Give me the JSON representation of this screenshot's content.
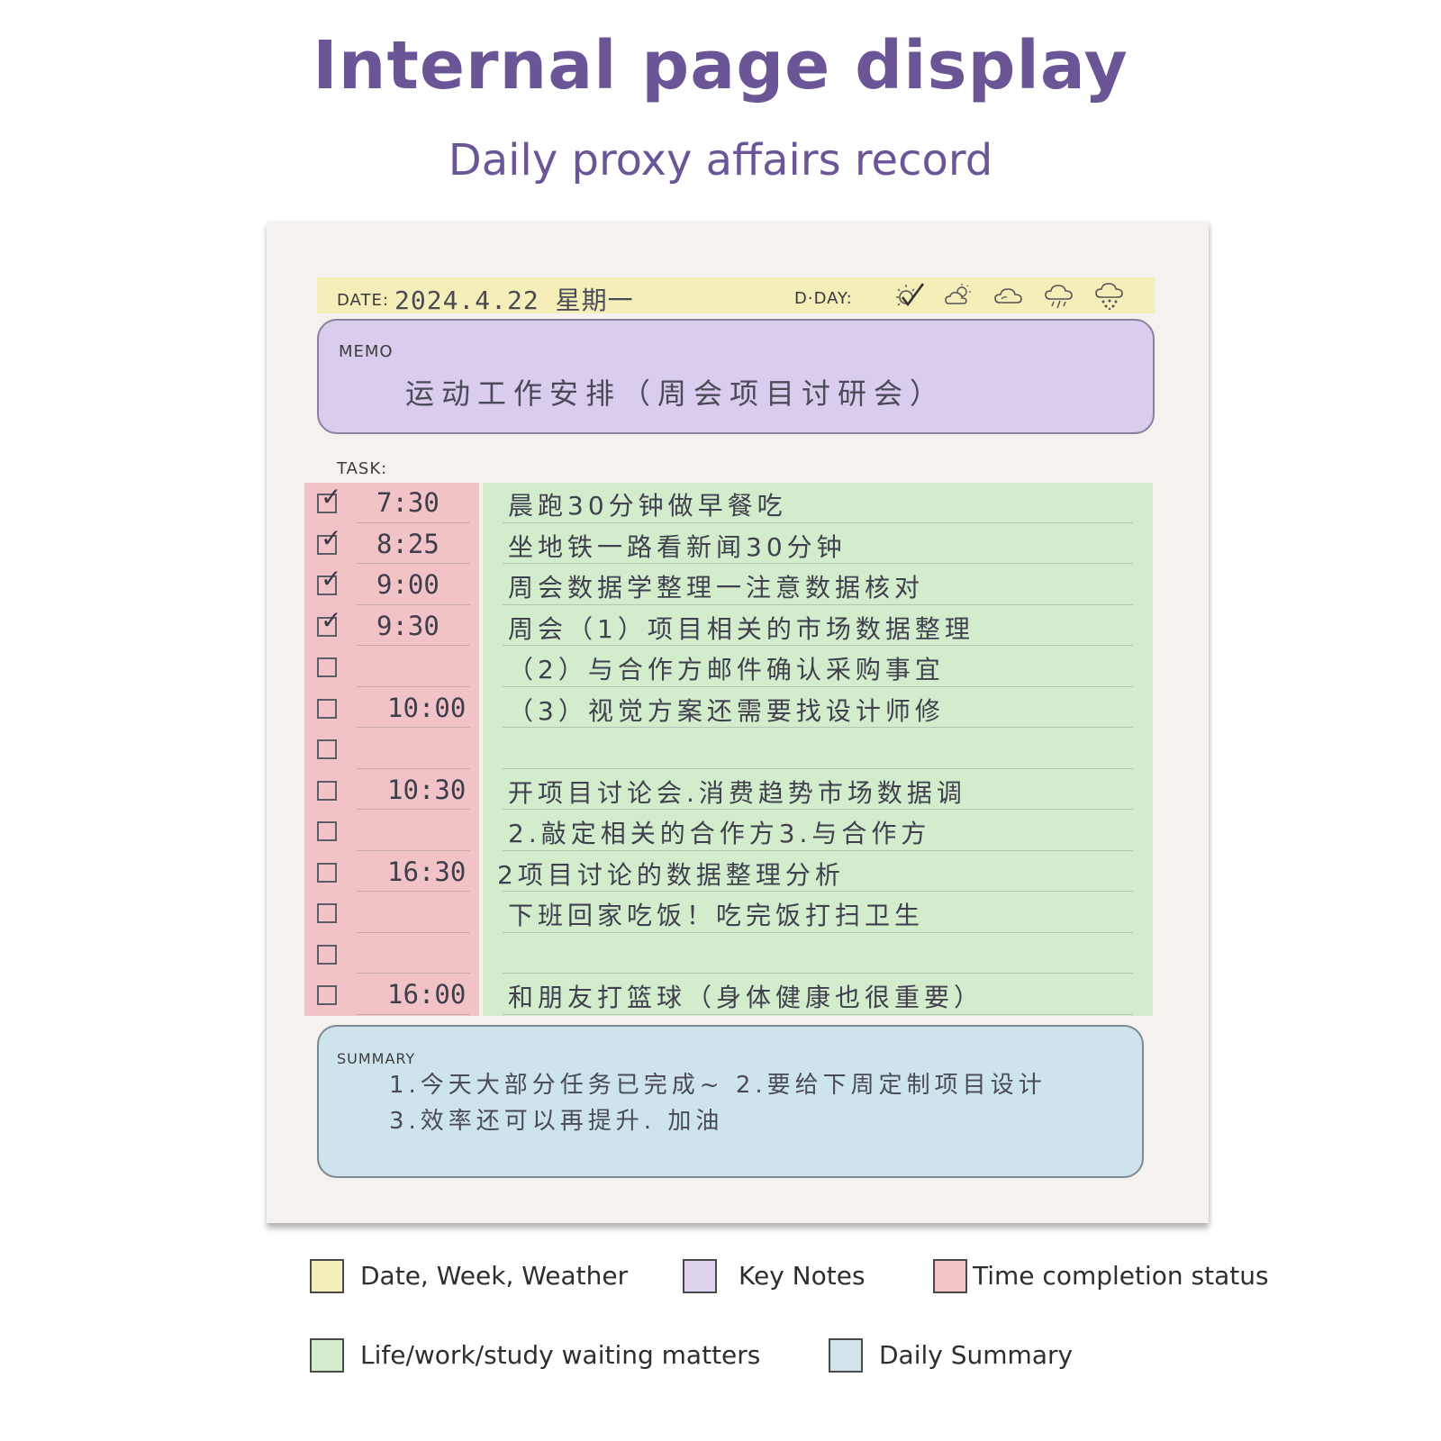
{
  "header": {
    "title": "Internal page display",
    "subtitle": "Daily proxy affairs record"
  },
  "planner": {
    "date_label": "DATE:",
    "date_value": "2024.4.22 星期一",
    "dday_label": "D·DAY:",
    "weather_icons": [
      "sunny-checked-icon",
      "partly-cloudy-icon",
      "cloudy-icon",
      "rain-icon",
      "snow-icon"
    ],
    "memo_label": "MEMO",
    "memo_text": "运动工作安排（周会项目讨研会）",
    "task_label": "TASK:",
    "tasks": [
      {
        "checked": true,
        "time": "7:30",
        "text": "晨跑30分钟做早餐吃"
      },
      {
        "checked": true,
        "time": "8:25",
        "text": "坐地铁一路看新闻30分钟"
      },
      {
        "checked": true,
        "time": "9:00",
        "text": "周会数据学整理一注意数据核对"
      },
      {
        "checked": true,
        "time": "9:30",
        "text": "周会（1）项目相关的市场数据整理"
      },
      {
        "checked": false,
        "time": "",
        "text": "（2）与合作方邮件确认采购事宜"
      },
      {
        "checked": false,
        "time": "10:00",
        "text": "（3）视觉方案还需要找设计师修"
      },
      {
        "checked": false,
        "time": "",
        "text": ""
      },
      {
        "checked": false,
        "time": "10:30",
        "text": "开项目讨论会.消费趋势市场数据调"
      },
      {
        "checked": false,
        "time": "",
        "text": "2.敲定相关的合作方3.与合作方"
      },
      {
        "checked": false,
        "time": "16:30",
        "text": "2项目讨论的数据整理分析"
      },
      {
        "checked": false,
        "time": "",
        "text": "下班回家吃饭！吃完饭打扫卫生"
      },
      {
        "checked": false,
        "time": "",
        "text": ""
      },
      {
        "checked": false,
        "time": "16:00",
        "text": "和朋友打篮球（身体健康也很重要）"
      }
    ],
    "summary_label": "SUMMARY",
    "summary_lines": [
      "1.今天大部分任务已完成~ 2.要给下周定制项目设计",
      "3.效率还可以再提升. 加油"
    ]
  },
  "legend": [
    {
      "label": "Date, Week, Weather",
      "color": "#f4eeb9"
    },
    {
      "label": "Key Notes",
      "color": "#ddd3ee"
    },
    {
      "label": "Time completion status",
      "color": "#f3c4c7"
    },
    {
      "label": "Life/work/study waiting matters",
      "color": "#d3edcd"
    },
    {
      "label": "Daily Summary",
      "color": "#d2e3e9"
    }
  ]
}
